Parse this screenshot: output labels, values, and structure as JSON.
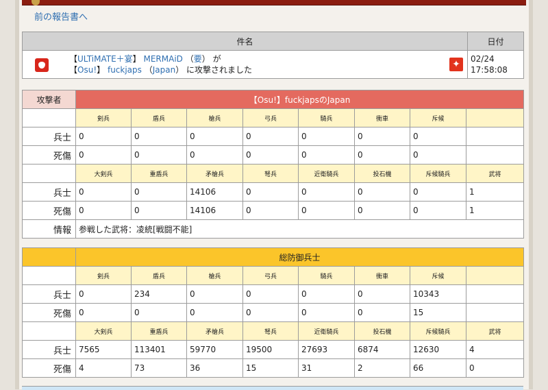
{
  "nav": {
    "back_label": "前の報告書へ"
  },
  "subject": {
    "col_title": "件名",
    "col_date": "日付",
    "attacker_tag": "ULTiMATE＋宴",
    "attacker_name": "MERMAiD",
    "attacker_country": "要",
    "ga": "が",
    "defender_tag": "Osu!",
    "defender_name": "fuckjaps",
    "defender_country": "Japan",
    "attacked_text": "に攻撃されました",
    "date": "02/24",
    "time": "17:58:08"
  },
  "units_row1": [
    "剣兵",
    "盾兵",
    "槍兵",
    "弓兵",
    "騎兵",
    "衝車",
    "斥候",
    ""
  ],
  "units_row2": [
    "大剣兵",
    "重盾兵",
    "矛槍兵",
    "弩兵",
    "近衛騎兵",
    "投石機",
    "斥候騎兵",
    "武将"
  ],
  "labels": {
    "soldiers": "兵士",
    "casualties": "死傷",
    "info": "情報"
  },
  "attacker": {
    "label": "攻撃者",
    "title_tag": "Osu!",
    "title_name": "fuckjaps",
    "title_no": "の",
    "title_country": "Japan",
    "r1_soldiers": [
      "0",
      "0",
      "0",
      "0",
      "0",
      "0",
      "0",
      ""
    ],
    "r1_casualties": [
      "0",
      "0",
      "0",
      "0",
      "0",
      "0",
      "0",
      ""
    ],
    "r2_soldiers": [
      "0",
      "0",
      "14106",
      "0",
      "0",
      "0",
      "0",
      "1"
    ],
    "r2_casualties": [
      "0",
      "0",
      "14106",
      "0",
      "0",
      "0",
      "0",
      "1"
    ],
    "info": "参戦した武将：凌統[戦闘不能]"
  },
  "defender": {
    "title": "総防御兵士",
    "r1_soldiers": [
      "0",
      "234",
      "0",
      "0",
      "0",
      "0",
      "10343",
      ""
    ],
    "r1_casualties": [
      "0",
      "0",
      "0",
      "0",
      "0",
      "0",
      "15",
      ""
    ],
    "r2_soldiers": [
      "7565",
      "113401",
      "59770",
      "19500",
      "27693",
      "6874",
      "12630",
      "4"
    ],
    "r2_casualties": [
      "4",
      "73",
      "36",
      "15",
      "31",
      "2",
      "66",
      "0"
    ]
  },
  "colors": {
    "attacker_header": "#e46a5f",
    "defender_header": "#fbc52a",
    "unit_header": "#fff5c7",
    "link": "#2f6fb1"
  }
}
